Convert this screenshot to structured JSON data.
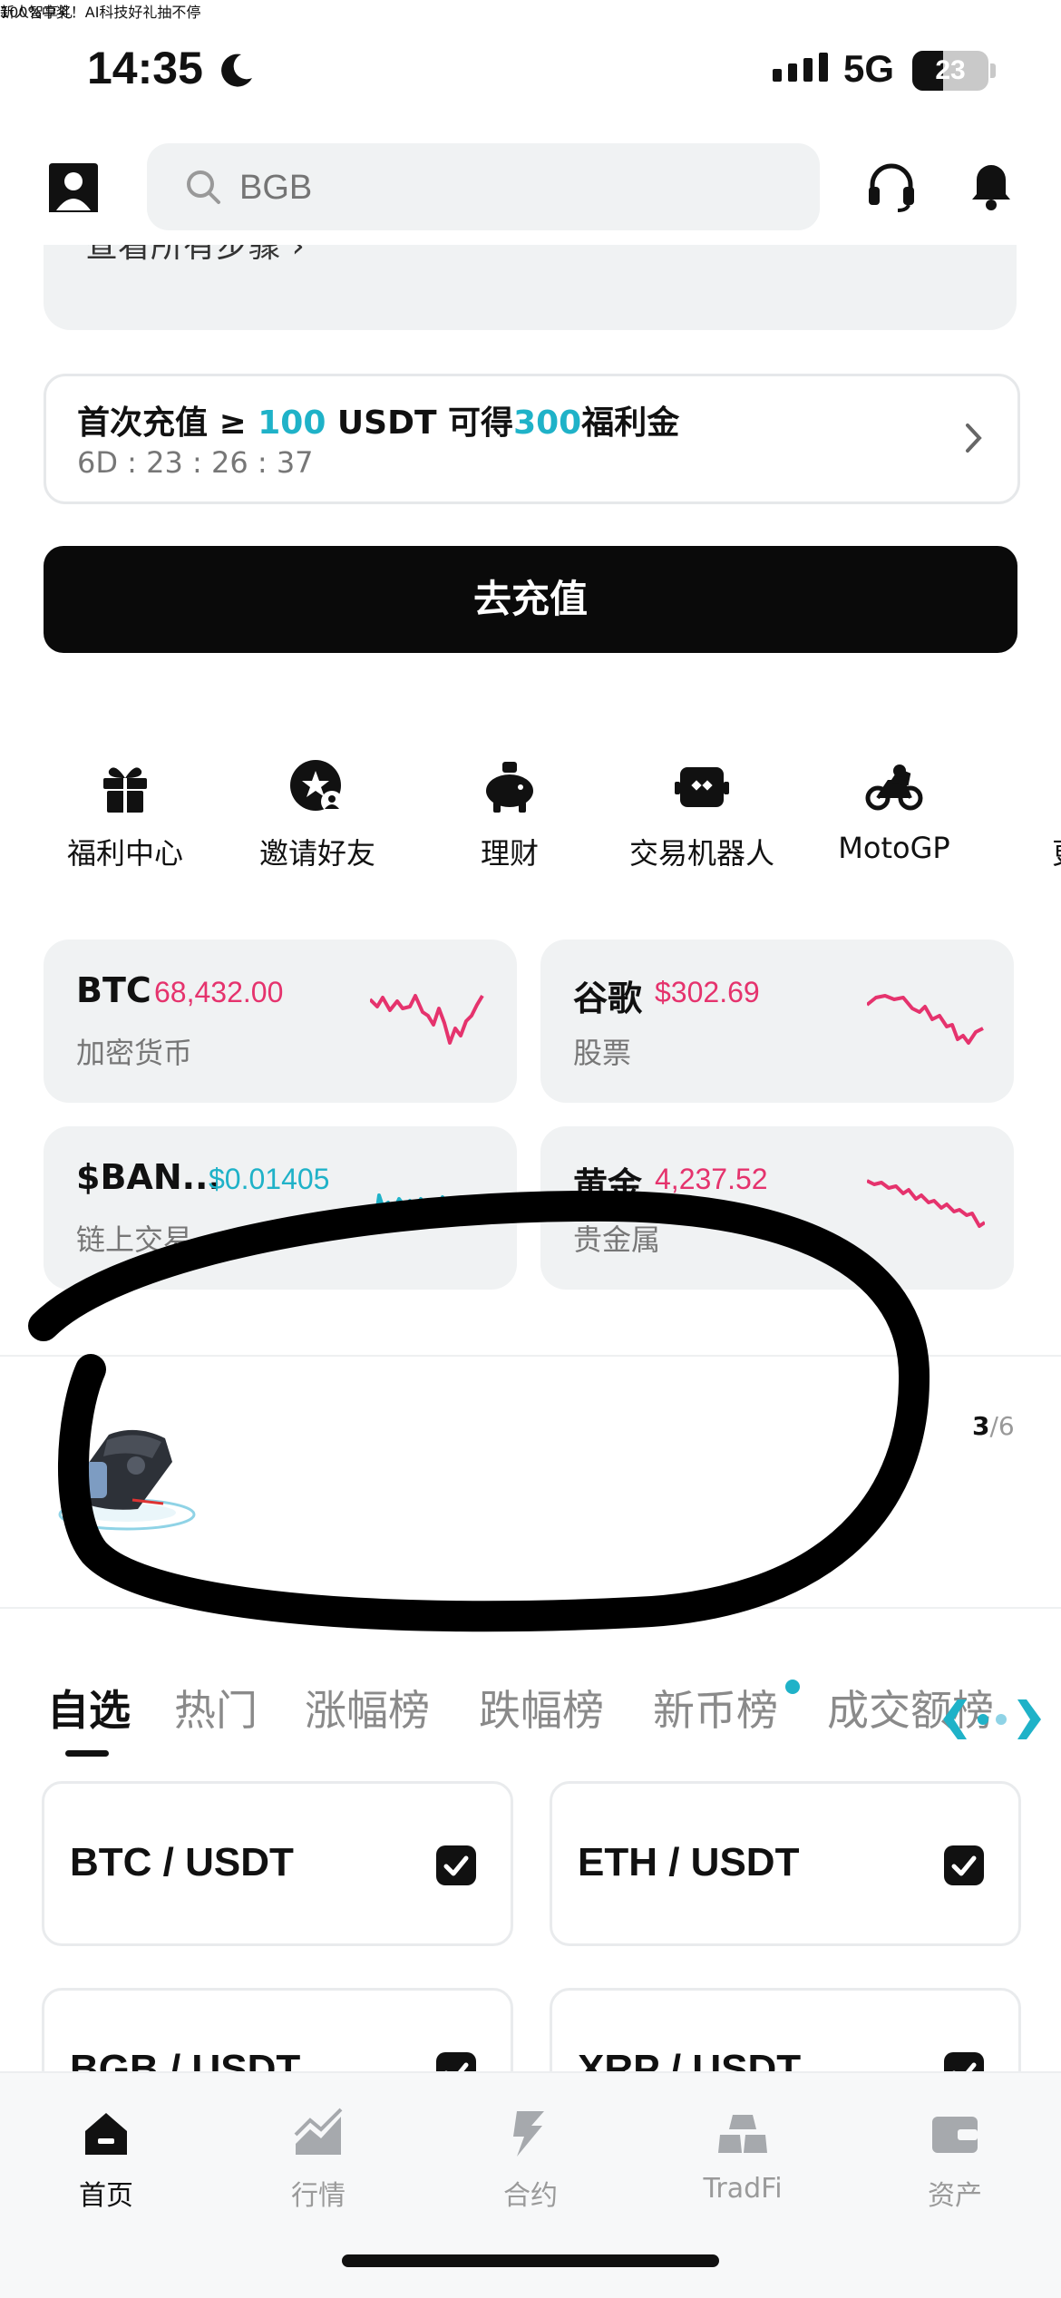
{
  "status_bar": {
    "time": "14:35",
    "network": "5G",
    "battery": "23"
  },
  "header": {
    "search_placeholder": "BGB"
  },
  "partial_card": {
    "text": "查看所有步骤 ›"
  },
  "deposit_banner": {
    "line1_prefix": "首次充值 ≥ ",
    "line1_amount": "100",
    "line1_mid": " USDT 可得",
    "line1_bonus": "300",
    "line1_suffix": "福利金",
    "countdown": "6D : 23 : 26 : 37"
  },
  "cta": {
    "label": "去充值"
  },
  "shortcuts": [
    {
      "label": "福利中心",
      "icon": "gift-icon"
    },
    {
      "label": "邀请好友",
      "icon": "invite-icon"
    },
    {
      "label": "理财",
      "icon": "piggy-bank-icon"
    },
    {
      "label": "交易机器人",
      "icon": "robot-icon"
    },
    {
      "label": "MotoGP",
      "icon": "motorcycle-icon"
    },
    {
      "label": "更",
      "icon": ""
    }
  ],
  "market_cards": [
    {
      "name": "BTC",
      "price": "68,432.00",
      "category": "加密货币",
      "color": "#e5336d"
    },
    {
      "name": "谷歌",
      "price": "$302.69",
      "category": "股票",
      "color": "#e5336d"
    },
    {
      "name": "$BAN...",
      "price": "$0.01405",
      "category": "链上交易",
      "color": "#1fb2c8"
    },
    {
      "name": "黄金",
      "price": "4,237.52",
      "category": "贵金属",
      "color": "#e5336d"
    }
  ],
  "promo": {
    "subtitle": "新人智享礼",
    "title": "100%中奖！AI科技好礼抽不停",
    "page_current": "3",
    "page_total": "/6"
  },
  "tabs": [
    "自选",
    "热门",
    "涨幅榜",
    "跌幅榜",
    "新币榜",
    "成交额榜"
  ],
  "pairs": [
    {
      "label": "BTC / USDT"
    },
    {
      "label": "ETH / USDT"
    },
    {
      "label": "BGB / USDT"
    },
    {
      "label": "XRP / USDT"
    }
  ],
  "bottom_nav": [
    {
      "label": "首页",
      "icon": "home-icon"
    },
    {
      "label": "行情",
      "icon": "market-chart-icon"
    },
    {
      "label": "合约",
      "icon": "futures-icon"
    },
    {
      "label": "TradFi",
      "icon": "tradfi-icon"
    },
    {
      "label": "资产",
      "icon": "wallet-icon"
    }
  ],
  "colors": {
    "accent": "#1fb2c8",
    "down": "#e5336d",
    "ink": "#111111",
    "card_bg": "#f0f2f3"
  }
}
